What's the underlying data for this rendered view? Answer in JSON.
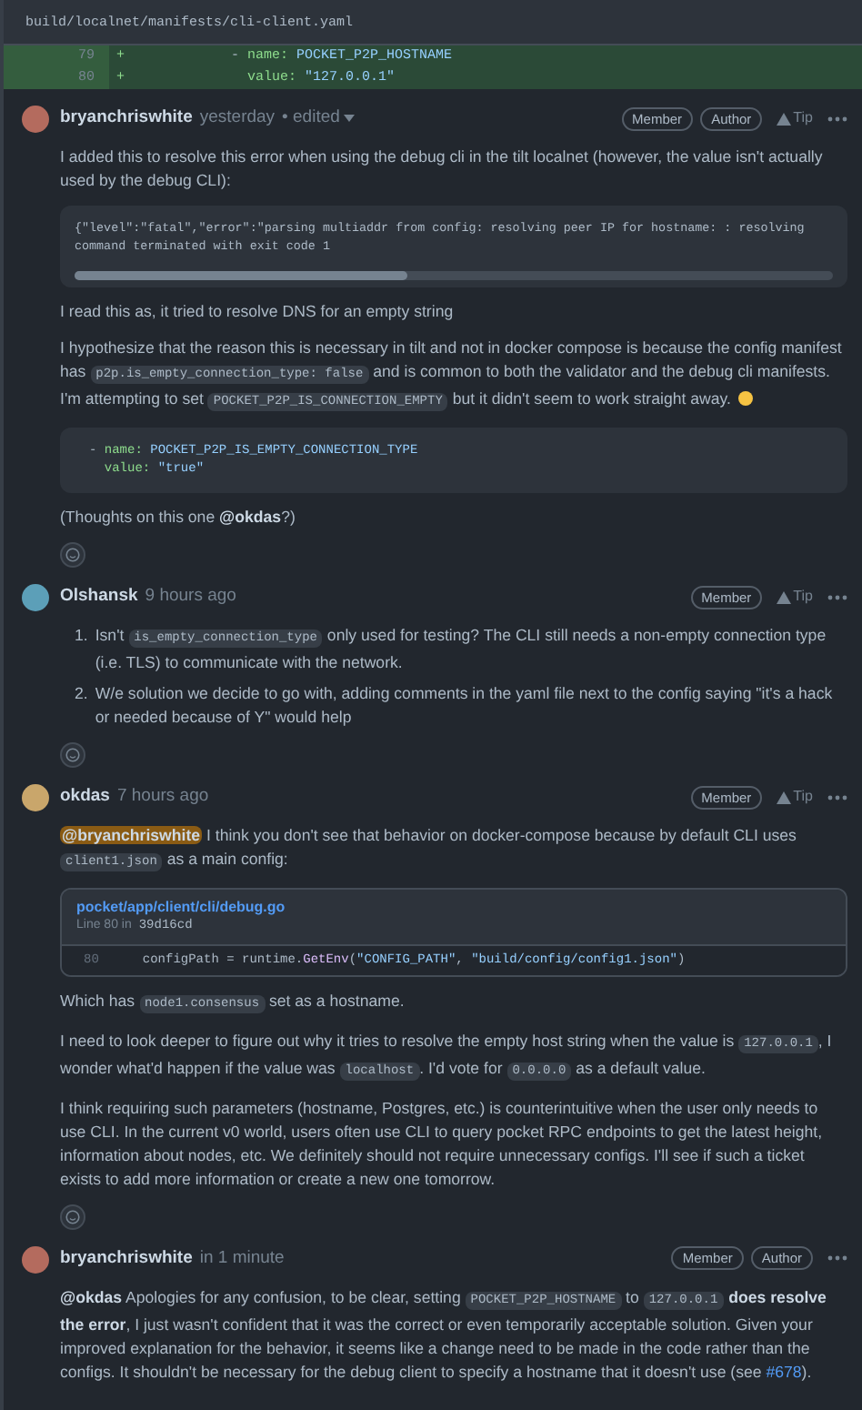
{
  "file_path": "build/localnet/manifests/cli-client.yaml",
  "diff_lines": [
    {
      "number": "79",
      "sign": "+",
      "dash": "- ",
      "key": "name:",
      "value": "POCKET_P2P_HOSTNAME"
    },
    {
      "number": "80",
      "sign": "+",
      "key": "value:",
      "value": "\"127.0.0.1\""
    }
  ],
  "comments": [
    {
      "author": "bryanchriswhite",
      "time": "yesterday",
      "edited": "• edited",
      "badges": [
        "Member",
        "Author"
      ],
      "tip": "Tip",
      "reactions_button": true,
      "blocks": [
        {
          "kind": "paragraph",
          "segments": [
            {
              "kind": "text",
              "text": "I added this to resolve this error when using the debug cli in the tilt localnet (however, the value isn't actually used by the debug CLI):"
            }
          ]
        },
        {
          "kind": "code_block",
          "lines": [
            "{\"level\":\"fatal\",\"error\":\"parsing multiaddr from config: resolving peer IP for hostname: : resolving",
            "command terminated with exit code 1"
          ]
        },
        {
          "kind": "paragraph",
          "segments": [
            {
              "kind": "text",
              "text": "I read this as, it tried to resolve DNS for an empty string"
            }
          ]
        },
        {
          "kind": "paragraph",
          "trailing_emoji": true,
          "segments": [
            {
              "kind": "text",
              "text": "I hypothesize that the reason this is necessary in tilt and not in docker compose is because the config manifest has "
            },
            {
              "kind": "code",
              "text": "p2p.is_empty_connection_type: false"
            },
            {
              "kind": "text",
              "text": " and is common to both the validator and the debug cli manifests. I'm attempting to set "
            },
            {
              "kind": "code",
              "text": "POCKET_P2P_IS_CONNECTION_EMPTY"
            },
            {
              "kind": "text",
              "text": " but it didn't seem to work straight away."
            }
          ]
        },
        {
          "kind": "yaml_block",
          "lines": [
            {
              "dash": "- ",
              "key": "name:",
              "value": "POCKET_P2P_IS_EMPTY_CONNECTION_TYPE"
            },
            {
              "key": "value:",
              "value": "\"true\""
            }
          ]
        },
        {
          "kind": "paragraph",
          "segments": [
            {
              "kind": "text",
              "text": "(Thoughts on this one "
            },
            {
              "kind": "mention",
              "text": "@okdas"
            },
            {
              "kind": "text",
              "text": "?)"
            }
          ]
        }
      ]
    },
    {
      "author": "Olshansk",
      "time": "9 hours ago",
      "badges": [
        "Member"
      ],
      "tip": "Tip",
      "reactions_button": true,
      "blocks": [
        {
          "kind": "list",
          "items": [
            {
              "marker": "1.",
              "segments": [
                {
                  "kind": "text",
                  "text": "Isn't "
                },
                {
                  "kind": "code",
                  "text": "is_empty_connection_type"
                },
                {
                  "kind": "text",
                  "text": " only used for testing? The CLI still needs a non-empty connection type (i.e. TLS) to communicate with the network."
                }
              ]
            },
            {
              "marker": "2.",
              "segments": [
                {
                  "kind": "text",
                  "text": "W/e solution we decide to go with, adding comments in the yaml file next to the config saying \"it's a hack or needed because of Y\" would help"
                }
              ]
            }
          ]
        }
      ]
    },
    {
      "author": "okdas",
      "time": "7 hours ago",
      "badges": [
        "Member"
      ],
      "tip": "Tip",
      "reactions_button": true,
      "blocks": [
        {
          "kind": "paragraph",
          "segments": [
            {
              "kind": "highlight",
              "text": "@bryanchriswhite"
            },
            {
              "kind": "text",
              "text": " I think you don't see that behavior on docker-compose because by default CLI uses "
            },
            {
              "kind": "code",
              "text": "client1.json"
            },
            {
              "kind": "text",
              "text": " as a main config:"
            }
          ]
        },
        {
          "kind": "permalink",
          "path": "pocket/app/client/cli/debug.go",
          "line_label": "Line 80 in",
          "commit": "39d16cd",
          "line_number": "80",
          "code": [
            {
              "kind": "plain",
              "text": "configPath = runtime."
            },
            {
              "kind": "func",
              "text": "GetEnv"
            },
            {
              "kind": "plain",
              "text": "("
            },
            {
              "kind": "string",
              "text": "\"CONFIG_PATH\""
            },
            {
              "kind": "plain",
              "text": ", "
            },
            {
              "kind": "string",
              "text": "\"build/config/config1.json\""
            },
            {
              "kind": "plain",
              "text": ")"
            }
          ]
        },
        {
          "kind": "paragraph",
          "segments": [
            {
              "kind": "text",
              "text": "Which has "
            },
            {
              "kind": "code",
              "text": "node1.consensus"
            },
            {
              "kind": "text",
              "text": " set as a hostname."
            }
          ]
        },
        {
          "kind": "paragraph",
          "segments": [
            {
              "kind": "text",
              "text": "I need to look deeper to figure out why it tries to resolve the empty host string when the value is "
            },
            {
              "kind": "code",
              "text": "127.0.0.1"
            },
            {
              "kind": "text",
              "text": ", I wonder what'd happen if the value was "
            },
            {
              "kind": "code",
              "text": "localhost"
            },
            {
              "kind": "text",
              "text": ". I'd vote for "
            },
            {
              "kind": "code",
              "text": "0.0.0.0"
            },
            {
              "kind": "text",
              "text": " as a default value."
            }
          ]
        },
        {
          "kind": "paragraph",
          "segments": [
            {
              "kind": "text",
              "text": "I think requiring such parameters (hostname, Postgres, etc.) is counterintuitive when the user only needs to use CLI. In the current v0 world, users often use CLI to query pocket RPC endpoints to get the latest height, information about nodes, etc. We definitely should not require unnecessary configs. I'll see if such a ticket exists to add more information or create a new one tomorrow."
            }
          ]
        }
      ]
    },
    {
      "author": "bryanchriswhite",
      "time": "in 1 minute",
      "badges": [
        "Member",
        "Author"
      ],
      "reactions_button": false,
      "blocks": [
        {
          "kind": "paragraph",
          "segments": [
            {
              "kind": "mention",
              "text": "@okdas"
            },
            {
              "kind": "text",
              "text": " Apologies for any confusion, to be clear, setting "
            },
            {
              "kind": "code",
              "text": "POCKET_P2P_HOSTNAME"
            },
            {
              "kind": "text",
              "text": " to "
            },
            {
              "kind": "code",
              "text": "127.0.0.1"
            },
            {
              "kind": "bold",
              "text": "does resolve the error"
            },
            {
              "kind": "text",
              "text": ", I just wasn't confident that it was the correct or even temporarily acceptable solution. Given your improved explanation for the behavior, it seems like a change need to be made in the code rather than the configs. It shouldn't be necessary for the debug client to specify a hostname that it doesn't use (see "
            },
            {
              "kind": "link",
              "text": "#678"
            },
            {
              "kind": "text",
              "text": ")."
            }
          ]
        }
      ]
    }
  ]
}
